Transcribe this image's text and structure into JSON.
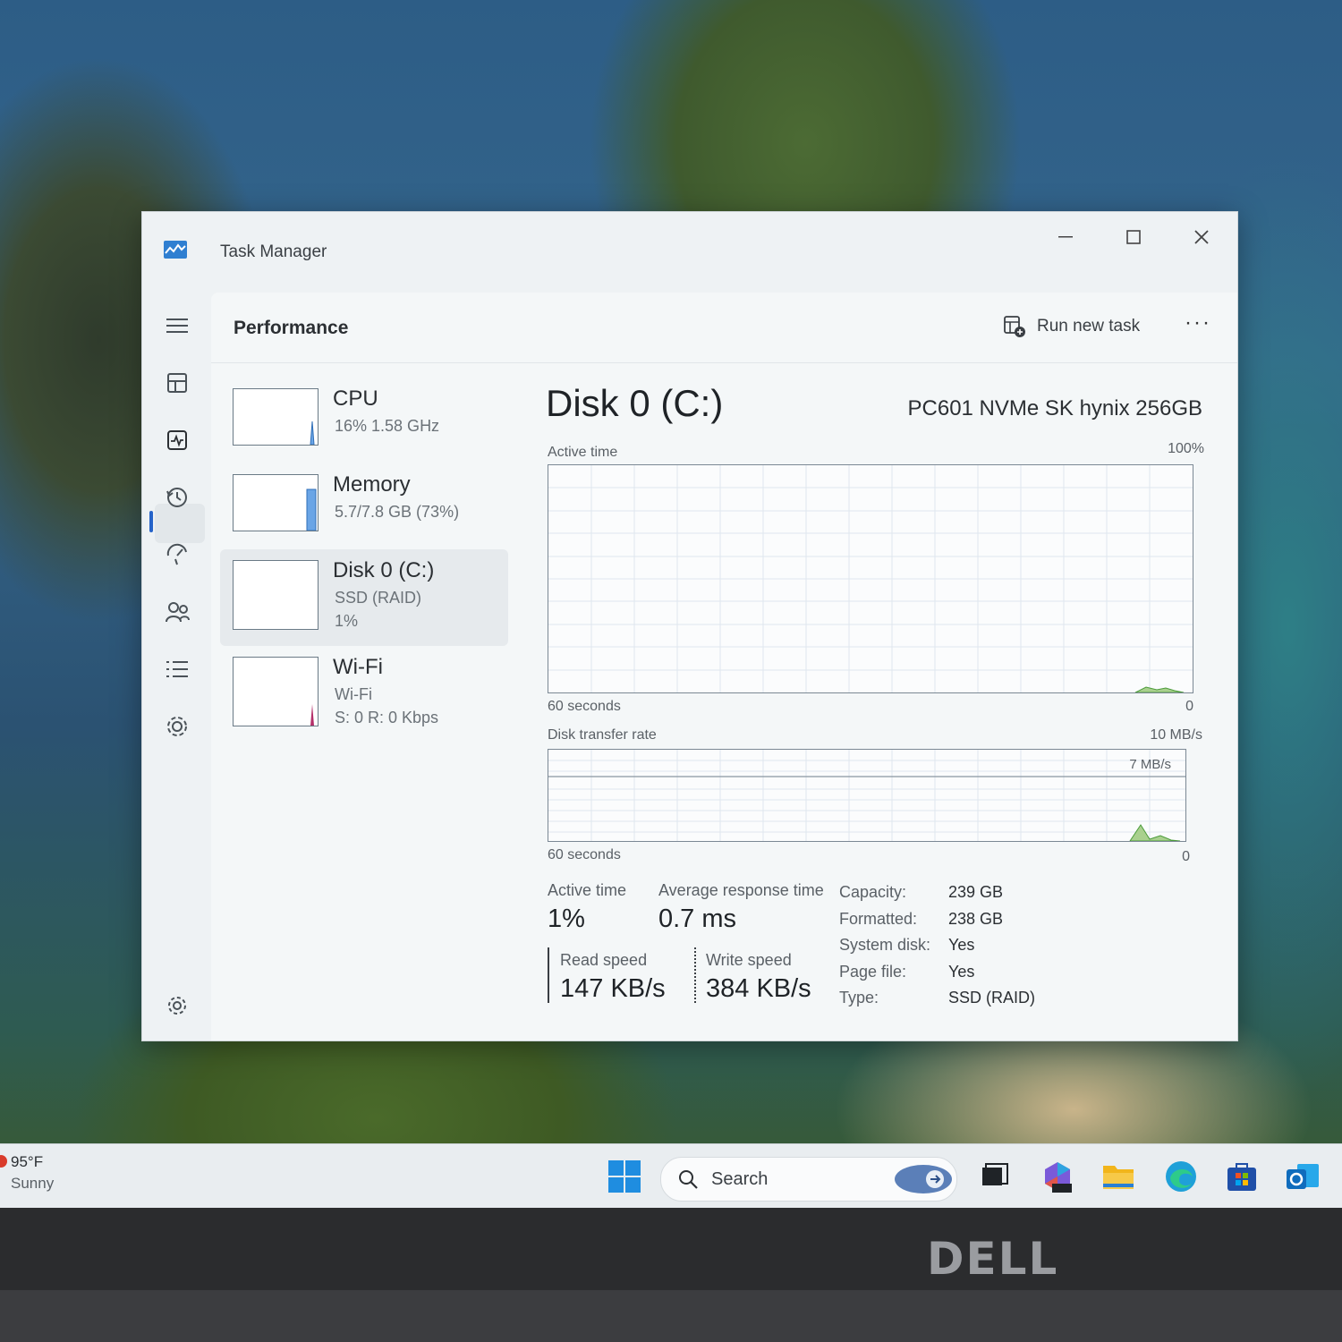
{
  "window": {
    "title": "Task Manager"
  },
  "sidebar": {
    "items": [
      {
        "name": "hamburger-menu-icon"
      },
      {
        "name": "processes-icon"
      },
      {
        "name": "performance-icon"
      },
      {
        "name": "app-history-icon"
      },
      {
        "name": "startup-apps-icon"
      },
      {
        "name": "users-icon"
      },
      {
        "name": "details-icon"
      },
      {
        "name": "services-icon"
      },
      {
        "name": "settings-icon"
      }
    ]
  },
  "header": {
    "title": "Performance",
    "run_task": "Run new task",
    "more": "···"
  },
  "resources": [
    {
      "name": "CPU",
      "line1": "16%  1.58 GHz",
      "line2": ""
    },
    {
      "name": "Memory",
      "line1": "5.7/7.8 GB (73%)",
      "line2": ""
    },
    {
      "name": "Disk 0 (C:)",
      "line1": "SSD (RAID)",
      "line2": "1%"
    },
    {
      "name": "Wi-Fi",
      "line1": "Wi-Fi",
      "line2": "S: 0 R: 0 Kbps"
    }
  ],
  "disk": {
    "title": "Disk 0 (C:)",
    "model": "PC601 NVMe SK hynix 256GB",
    "chart1": {
      "label": "Active time",
      "max": "100%",
      "x_left": "60 seconds",
      "x_right": "0"
    },
    "chart2": {
      "label": "Disk transfer rate",
      "max": "10 MB/s",
      "mid": "7 MB/s",
      "x_left": "60 seconds",
      "x_right": "0"
    },
    "stats": {
      "active_time_label": "Active time",
      "active_time": "1%",
      "avg_resp_label": "Average response time",
      "avg_resp": "0.7 ms",
      "read_label": "Read speed",
      "read": "147 KB/s",
      "write_label": "Write speed",
      "write": "384 KB/s"
    },
    "props": [
      {
        "k": "Capacity:",
        "v": "239 GB"
      },
      {
        "k": "Formatted:",
        "v": "238 GB"
      },
      {
        "k": "System disk:",
        "v": "Yes"
      },
      {
        "k": "Page file:",
        "v": "Yes"
      },
      {
        "k": "Type:",
        "v": "SSD (RAID)"
      }
    ]
  },
  "taskbar": {
    "weather_temp": "95°F",
    "weather_desc": "Sunny",
    "search": "Search",
    "pinned": [
      "start-icon",
      "copilot-icon",
      "task-view-icon",
      "microsoft-365-icon",
      "file-explorer-icon",
      "edge-icon",
      "store-icon",
      "outlook-icon"
    ]
  },
  "device": {
    "brand": "DELL"
  },
  "colors": {
    "accent": "#2563c9",
    "disk_graph": "#4b9b3a",
    "memory_graph": "#6aa5e6",
    "wifi_graph": "#b4306a"
  }
}
